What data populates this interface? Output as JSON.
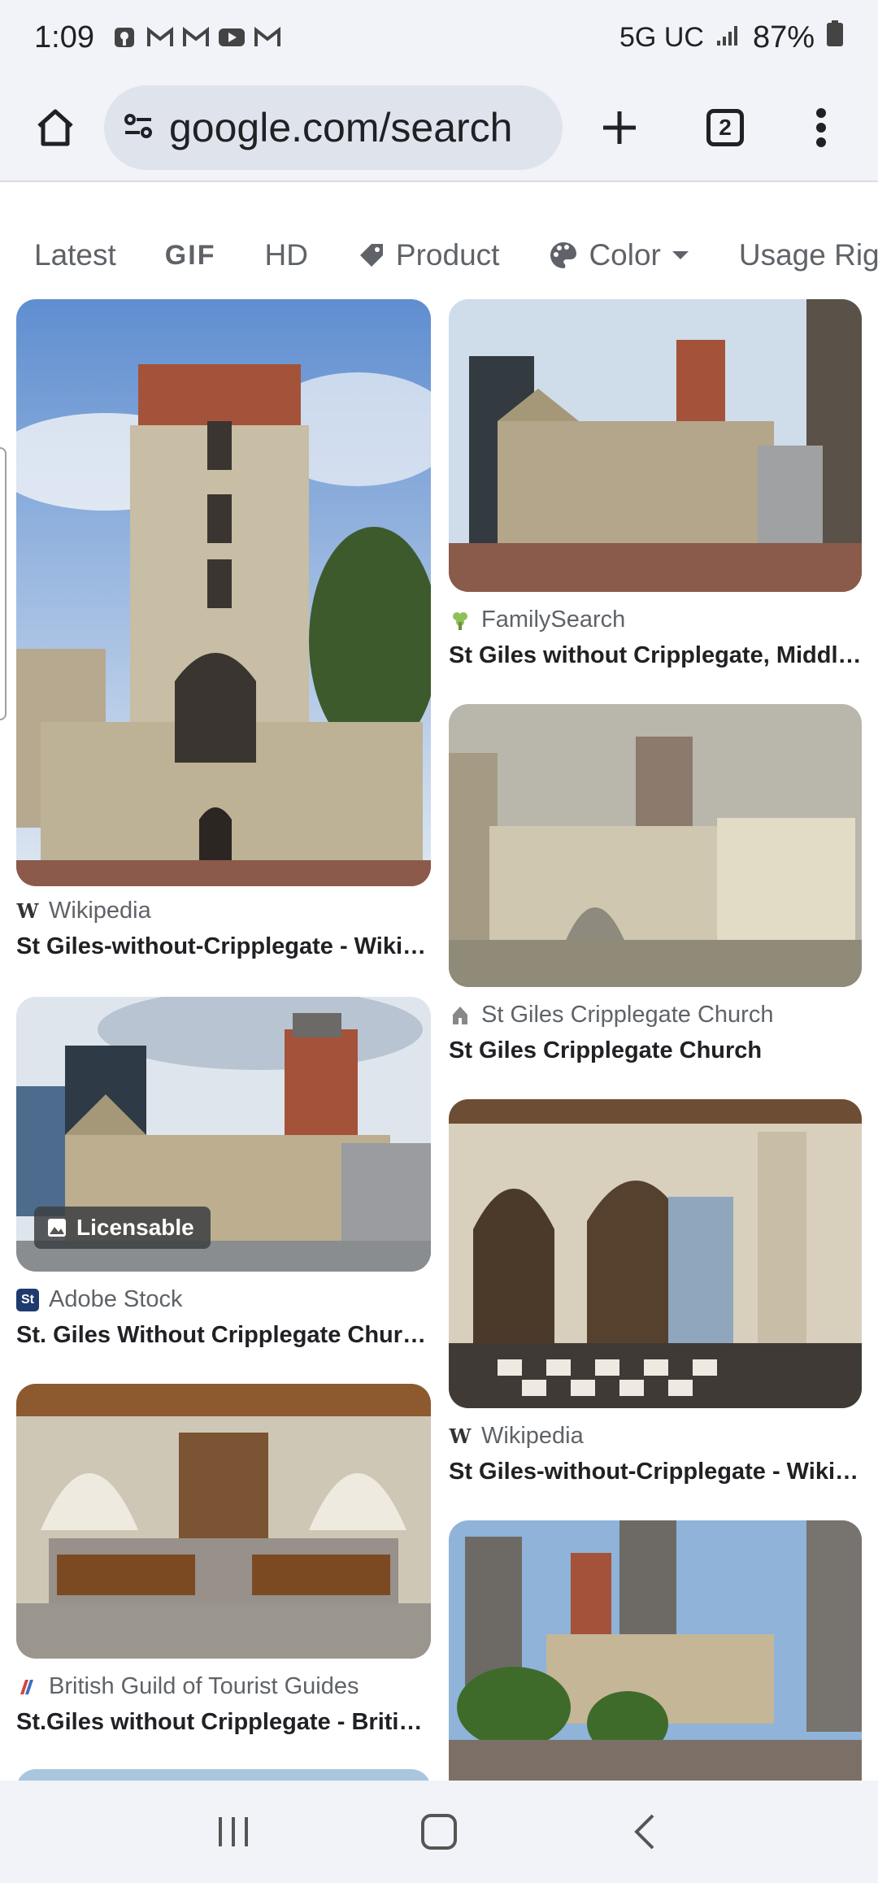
{
  "status_bar": {
    "time": "1:09",
    "network": "5G UC",
    "battery": "87%",
    "notification_icons": [
      "podcast-icon",
      "gmail-icon",
      "gmail-icon",
      "youtube-icon",
      "gmail-icon"
    ]
  },
  "toolbar": {
    "url": "google.com/search",
    "tab_count": "2"
  },
  "filters": {
    "chips": [
      {
        "label": "Latest",
        "icon": ""
      },
      {
        "label": "GIF",
        "icon": ""
      },
      {
        "label": "HD",
        "icon": ""
      },
      {
        "label": "Product",
        "icon": "tag-icon"
      },
      {
        "label": "Color",
        "icon": "palette-icon"
      },
      {
        "label": "Usage Righ",
        "icon": ""
      }
    ]
  },
  "results": {
    "left": [
      {
        "source": "Wikipedia",
        "title": "St Giles-without-Cripplegate - Wiki…",
        "favicon": "W"
      },
      {
        "source": "Adobe Stock",
        "title": "St. Giles Without Cripplegate Chur…",
        "favicon": "St",
        "badge": "Licensable"
      },
      {
        "source": "British Guild of Tourist Guides",
        "title": "St.Giles without Cripplegate - Briti…",
        "favicon": ""
      }
    ],
    "right": [
      {
        "source": "FamilySearch",
        "title": "St Giles without Cripplegate, Middl…",
        "favicon": ""
      },
      {
        "source": "St Giles Cripplegate Church",
        "title": "St Giles Cripplegate Church",
        "favicon": ""
      },
      {
        "source": "Wikipedia",
        "title": "St Giles-without-Cripplegate - Wiki…",
        "favicon": "W"
      }
    ]
  },
  "colors": {
    "chrome_bg": "#f1f3f9",
    "url_box_bg": "#dfe3ec",
    "text_primary": "#202124",
    "text_secondary": "#5f6368"
  }
}
